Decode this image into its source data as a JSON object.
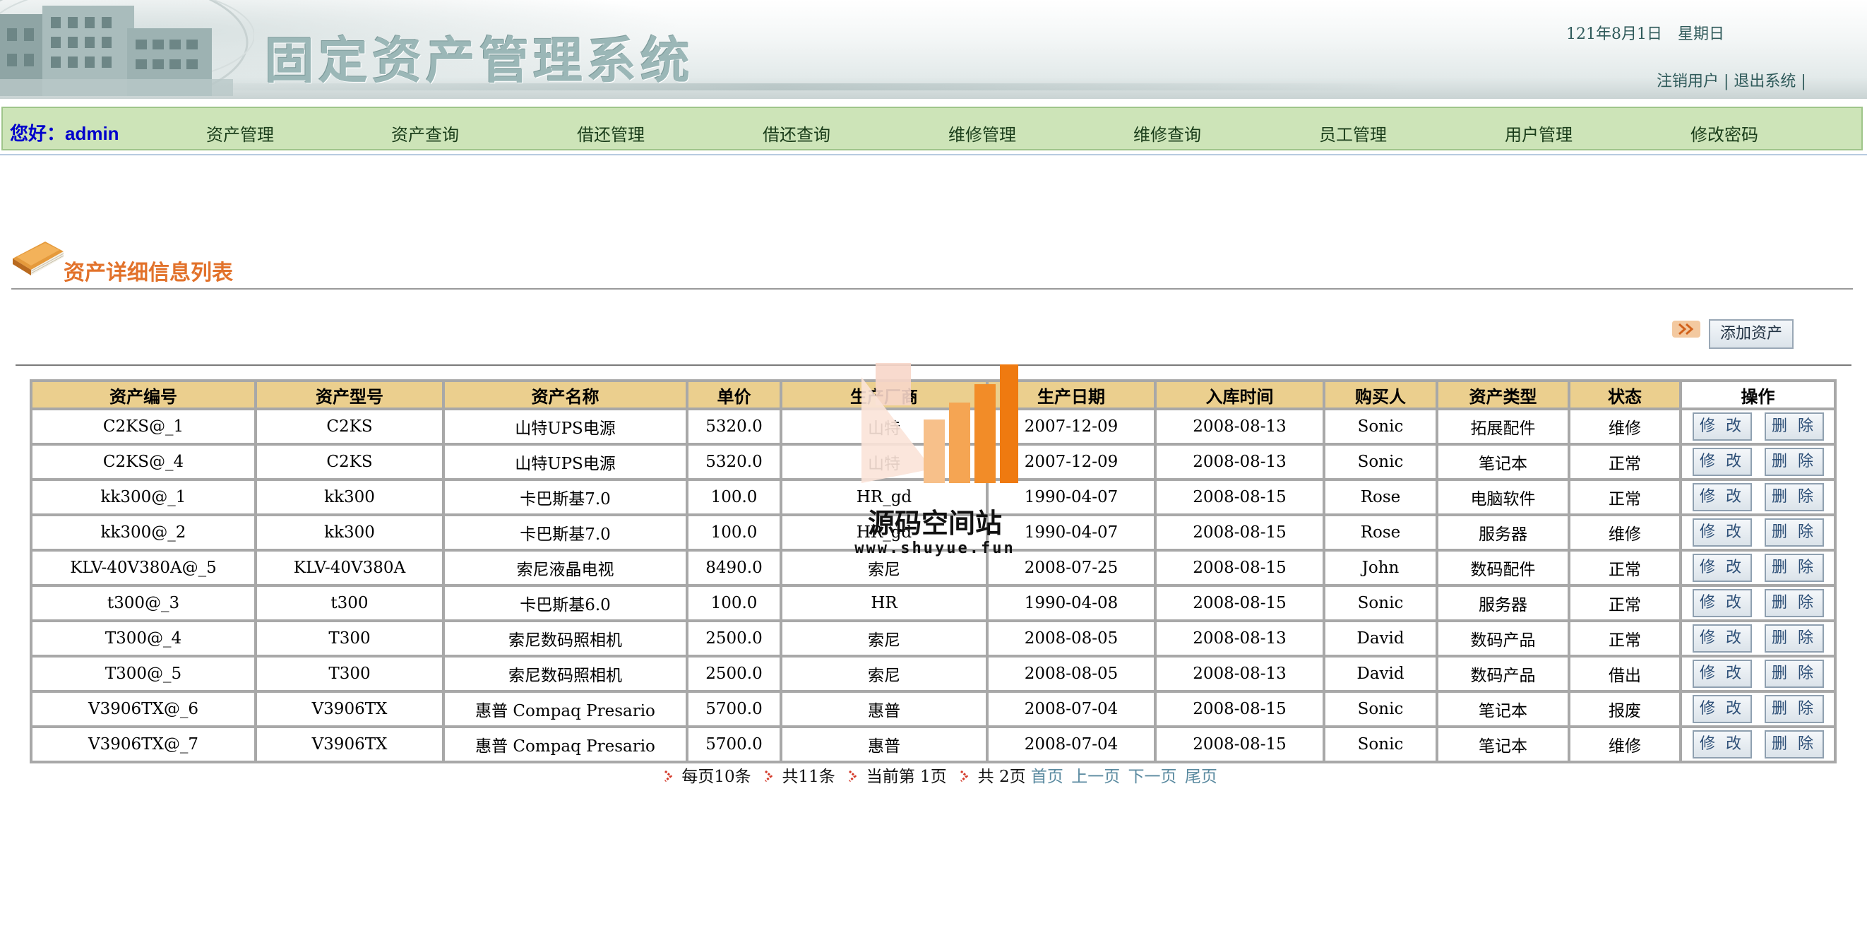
{
  "header": {
    "system_title": "固定资产管理系统",
    "date": "121年8月1日　星期日",
    "logout_link": "注销用户",
    "exit_link": "退出系统"
  },
  "nav": {
    "greeting": "您好：admin",
    "items": [
      "资产管理",
      "资产查询",
      "借还管理",
      "借还查询",
      "维修管理",
      "维修查询",
      "员工管理",
      "用户管理",
      "修改密码"
    ]
  },
  "section": {
    "title": "资产详细信息列表",
    "add_button": "添加资产"
  },
  "table": {
    "columns": [
      "资产编号",
      "资产型号",
      "资产名称",
      "单价",
      "生产厂商",
      "生产日期",
      "入库时间",
      "购买人",
      "资产类型",
      "状态",
      "操作"
    ],
    "edit_label": "修 改",
    "delete_label": "删 除",
    "rows": [
      [
        "C2KS@_1",
        "C2KS",
        "山特UPS电源",
        "5320.0",
        "山特",
        "2007-12-09",
        "2008-08-13",
        "Sonic",
        "拓展配件",
        "维修"
      ],
      [
        "C2KS@_4",
        "C2KS",
        "山特UPS电源",
        "5320.0",
        "山特",
        "2007-12-09",
        "2008-08-13",
        "Sonic",
        "笔记本",
        "正常"
      ],
      [
        "kk300@_1",
        "kk300",
        "卡巴斯基7.0",
        "100.0",
        "HR_gd",
        "1990-04-07",
        "2008-08-15",
        "Rose",
        "电脑软件",
        "正常"
      ],
      [
        "kk300@_2",
        "kk300",
        "卡巴斯基7.0",
        "100.0",
        "HR_gd",
        "1990-04-07",
        "2008-08-15",
        "Rose",
        "服务器",
        "维修"
      ],
      [
        "KLV-40V380A@_5",
        "KLV-40V380A",
        "索尼液晶电视",
        "8490.0",
        "索尼",
        "2008-07-25",
        "2008-08-15",
        "John",
        "数码配件",
        "正常"
      ],
      [
        "t300@_3",
        "t300",
        "卡巴斯基6.0",
        "100.0",
        "HR",
        "1990-04-08",
        "2008-08-15",
        "Sonic",
        "服务器",
        "正常"
      ],
      [
        "T300@_4",
        "T300",
        "索尼数码照相机",
        "2500.0",
        "索尼",
        "2008-08-05",
        "2008-08-13",
        "David",
        "数码产品",
        "正常"
      ],
      [
        "T300@_5",
        "T300",
        "索尼数码照相机",
        "2500.0",
        "索尼",
        "2008-08-05",
        "2008-08-13",
        "David",
        "数码产品",
        "借出"
      ],
      [
        "V3906TX@_6",
        "V3906TX",
        "惠普 Compaq Presario",
        "5700.0",
        "惠普",
        "2008-07-04",
        "2008-08-15",
        "Sonic",
        "笔记本",
        "报废"
      ],
      [
        "V3906TX@_7",
        "V3906TX",
        "惠普 Compaq Presario",
        "5700.0",
        "惠普",
        "2008-07-04",
        "2008-08-15",
        "Sonic",
        "笔记本",
        "维修"
      ]
    ]
  },
  "pager": {
    "per_page": "每页10条",
    "total": "共11条",
    "current": "当前第 1页",
    "pages": "共 2页",
    "first": "首页",
    "prev": "上一页",
    "next": "下一页",
    "last": "尾页"
  },
  "watermark": {
    "name": "源码空间站",
    "url": "www.shuyue.fun"
  },
  "colors": {
    "nav_bg": "#cde4b8",
    "table_header_bg": "#ebcf8e",
    "section_title": "#e2722b",
    "greeting": "#0000cc"
  }
}
